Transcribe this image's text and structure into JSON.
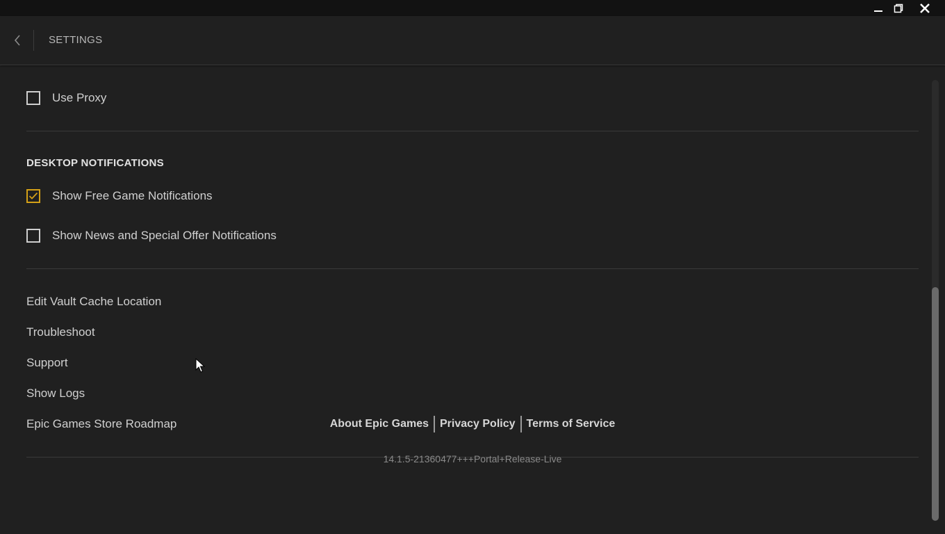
{
  "window": {
    "minimize_icon": "minimize-icon",
    "maximize_icon": "restore-icon",
    "close_icon": "close-icon"
  },
  "header": {
    "back_icon": "chevron-left-icon",
    "title": "SETTINGS"
  },
  "settings": {
    "use_proxy": {
      "label": "Use Proxy",
      "checked": false
    },
    "desktop_notifications": {
      "heading": "DESKTOP NOTIFICATIONS",
      "free_games": {
        "label": "Show Free Game Notifications",
        "checked": true
      },
      "news_offers": {
        "label": "Show News and Special Offer Notifications",
        "checked": false
      }
    },
    "links": [
      "Edit Vault Cache Location",
      "Troubleshoot",
      "Support",
      "Show Logs",
      "Epic Games Store Roadmap"
    ]
  },
  "footer": {
    "about": "About Epic Games",
    "privacy": "Privacy Policy",
    "terms": "Terms of Service",
    "version": "14.1.5-21360477+++Portal+Release-Live"
  },
  "colors": {
    "accent": "#d4a017",
    "background": "#202020",
    "titlebar": "#121212"
  }
}
